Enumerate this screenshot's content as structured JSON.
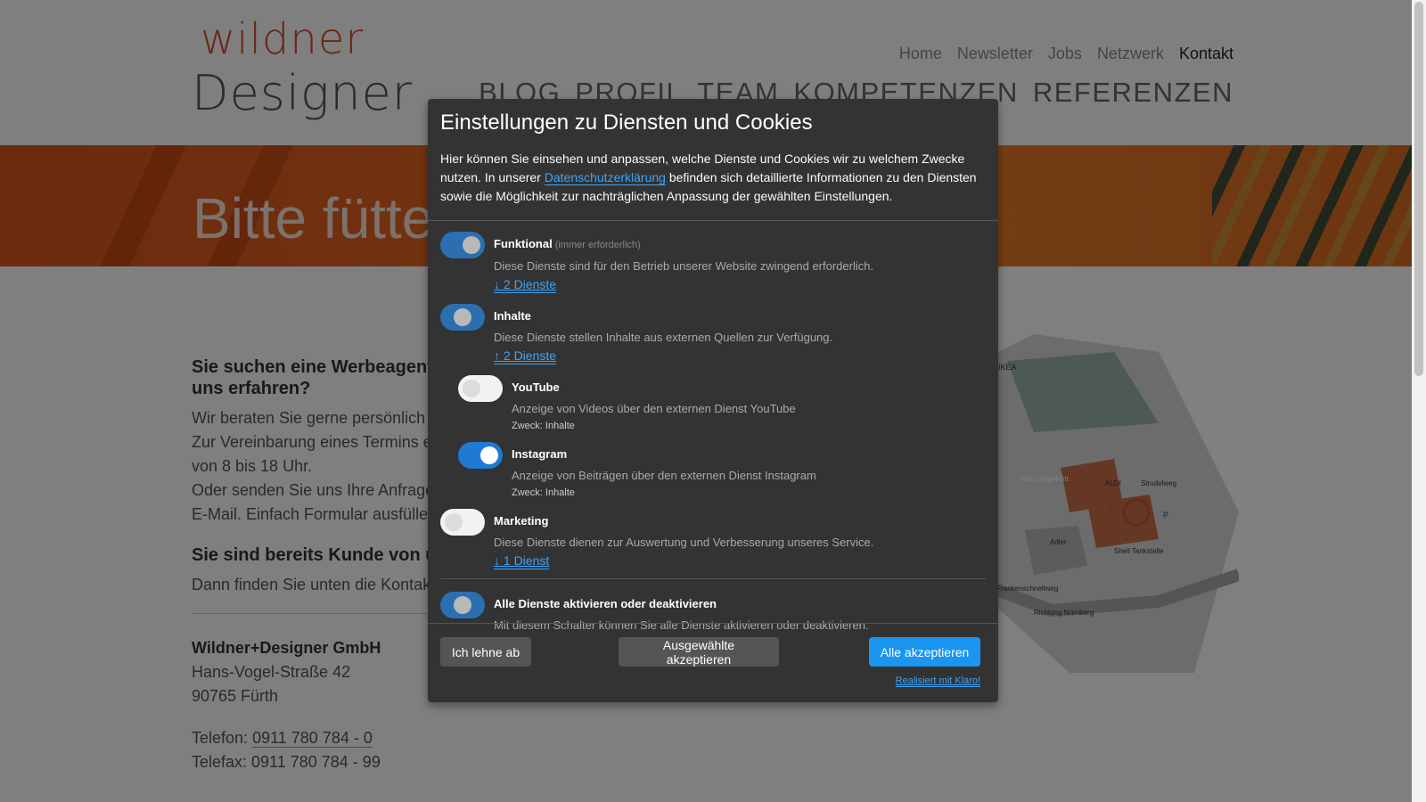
{
  "logo": {
    "line1": "wildner",
    "line2": "Designer"
  },
  "meta_nav": [
    "Home",
    "Newsletter",
    "Jobs",
    "Netzwerk",
    "Kontakt"
  ],
  "main_nav": [
    "BLOG",
    "PROFIL",
    "TEAM",
    "KOMPETENZEN",
    "REFERENZEN"
  ],
  "banner": {
    "title": "Bitte fütte"
  },
  "content": {
    "heading1": "Sie suchen eine Werbeagentu\nuns erfahren?",
    "heading1_a": "Sie suchen eine Werbeagentu",
    "heading1_b": "uns erfahren?",
    "para1_l1": "Wir beraten Sie gerne persönlich",
    "para1_l2": "Zur Vereinbarung eines Termins e",
    "para1_l3": "von 8 bis 18 Uhr.",
    "para1_l4": "Oder senden Sie uns Ihre Anfrage",
    "para1_l5": "E-Mail. Einfach Formular ausfülle",
    "heading2": "Sie sind bereits Kunde von un",
    "para2": "Dann finden Sie unten die Kontak",
    "company": "Wildner+Designer GmbH",
    "street": "Hans-Vogel-Straße 42",
    "city": "90765 Fürth",
    "phone_label": "Telefon:",
    "phone": "0911 780 784 - 0",
    "fax": "Telefax: 0911 780 784 - 99"
  },
  "map": {
    "labels": [
      "IKEA",
      "Hans-Vogel-Str.",
      "ALDI",
      "Strudelweg",
      "Adler",
      "Shell Tankstelle",
      "A 73 Frankenschnellweg",
      "Richtung Nürnberg",
      "42",
      "P"
    ]
  },
  "modal": {
    "title": "Einstellungen zu Diensten und Cookies",
    "intro_before": "Hier können Sie einsehen und anpassen, welche Dienste und Cookies wir zu welchem Zwecke nutzen. In unserer ",
    "intro_link": "Datenschutzerklärung",
    "intro_after": " befinden sich detaillierte Informationen zu den Diensten sowie die Möglichkeit zur nachträglichen Anpassung der gewählten Einstellungen.",
    "purposes": {
      "funktional": {
        "title": "Funktional",
        "required": "(immer erforderlich)",
        "desc": "Diese Dienste sind für den Betrieb unserer Website zwingend erforderlich.",
        "services": "↓ 2 Dienste"
      },
      "inhalte": {
        "title": "Inhalte",
        "desc": "Diese Dienste stellen Inhalte aus externen Quellen zur Verfügung.",
        "services": "↑ 2 Dienste"
      },
      "youtube": {
        "title": "YouTube",
        "desc": "Anzeige von Videos über den externen Dienst YouTube",
        "purpose": "Zweck: Inhalte"
      },
      "instagram": {
        "title": "Instagram",
        "desc": "Anzeige von Beiträgen über den externen Dienst Instagram",
        "purpose": "Zweck: Inhalte"
      },
      "marketing": {
        "title": "Marketing",
        "desc": "Diese Dienste dienen zur Auswertung und Verbesserung unseres Service.",
        "services": "↓ 1 Dienst"
      },
      "all": {
        "title": "Alle Dienste aktivieren oder deaktivieren",
        "desc": "Mit diesem Schalter können Sie alle Dienste aktivieren oder deaktivieren."
      }
    },
    "buttons": {
      "decline": "Ich lehne ab",
      "accept_selected": "Ausgewählte akzeptieren",
      "accept_all": "Alle akzeptieren"
    },
    "powered_by": "Realisiert mit Klaro!"
  }
}
